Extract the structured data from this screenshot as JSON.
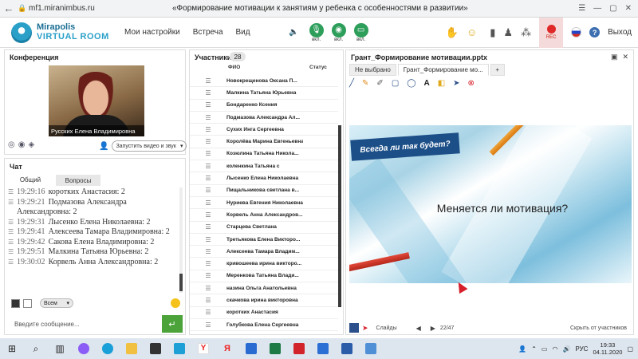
{
  "browser": {
    "url": "mf1.miranimbus.ru",
    "page_title": "«Формирование мотивации к занятиям у ребенка с особенностями в развитии»"
  },
  "header": {
    "logo_line1": "Mirapolis",
    "logo_line2": "VIRTUAL ROOM",
    "menu": [
      "Мои настройки",
      "Встреча",
      "Вид"
    ],
    "media_labels": [
      "вкл.",
      "вкл.",
      "вкл."
    ],
    "rec_label": "REC",
    "exit_label": "Выход"
  },
  "conference": {
    "title": "Конференция",
    "video_caption": "Русских Елена Владимировна",
    "start_select": "Запустить видео и звук"
  },
  "chat": {
    "title": "Чат",
    "tabs": [
      "Общий",
      "Вопросы"
    ],
    "messages": [
      {
        "time": "19:29:16",
        "text": "коротких Анастасия: 2"
      },
      {
        "time": "19:29:21",
        "text": "Подмазова Александра Александровна: 2"
      },
      {
        "time": "19:29:31",
        "text": "Лысенко Елена  Николаевна: 2"
      },
      {
        "time": "19:29:41",
        "text": "Алексеева  Тамара Владимировна: 2"
      },
      {
        "time": "19:29:42",
        "text": "Сакова Елена Владимировна: 2"
      },
      {
        "time": "19:29:51",
        "text": "Малкина Татьяна  Юрьевна: 2"
      },
      {
        "time": "19:30:02",
        "text": "Корвель Анна  Александровна: 2"
      }
    ],
    "scope": "Всем",
    "input_placeholder": "Введите сообщение..."
  },
  "participants": {
    "title": "Участники",
    "count": "28",
    "col_name": "ФИО",
    "col_status": "Статус",
    "rows": [
      "Новокрещенова  Оксана  П...",
      "Малкина Татьяна  Юрьевна",
      "Бондаренко  Ксения",
      "Подмазова Александра  Ал...",
      "Сухих  Инга Сергеевна",
      "Королёва Марина Евгеньевна",
      "Козюлина  Татьяна Никола...",
      "коленкина Татьяна  с",
      "Лысенко Елена  Николаевна",
      "Пищальникова  светлана в...",
      "Нуриева Евгения Николаевна",
      "Корвель Анна  Александров...",
      "Старцева Светлана",
      "Третьякова  Елена Викторо...",
      "Алексеева  Тамара  Владим...",
      "кривошеева  ирина викторо...",
      "Меренкова  Татьяна  Влади...",
      "назина  Ольга Анатольевна",
      "скачкова ирина викторовна",
      "коротких Анастасия",
      "Голубкова  Елена Сергеевна"
    ]
  },
  "presentation": {
    "title": "Грант_Формирование мотивации.pptx",
    "tabs": [
      "Не выбрано",
      "Грант_Формирование мо..."
    ],
    "tag_text": "Всегда ли так будет?",
    "main_text": "Меняется ли мотивация?",
    "slides_label": "Слайды",
    "page_current": "22",
    "page_total": "/47",
    "hide_label": "Скрыть от участников"
  },
  "taskbar": {
    "lang": "РУС",
    "time": "19:33",
    "date": "04.11.2020"
  },
  "colors": {
    "brand": "#2aa0c8",
    "media_on": "#2e9e5b",
    "rec": "#e02828",
    "send": "#4ba33a",
    "slide_tag": "#1c4f88"
  }
}
